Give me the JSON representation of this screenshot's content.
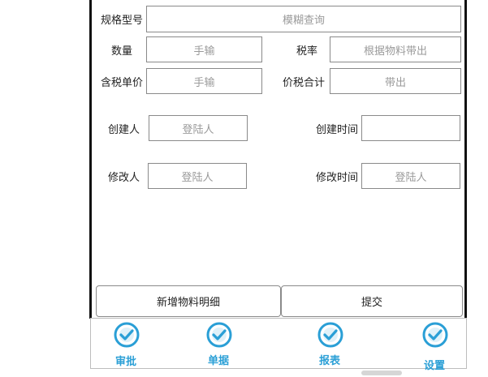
{
  "form": {
    "spec_label": "规格型号",
    "spec_placeholder": "模糊查询",
    "qty_label": "数量",
    "qty_placeholder": "手输",
    "tax_rate_label": "税率",
    "tax_rate_placeholder": "根据物料带出",
    "unit_price_label": "含税单价",
    "unit_price_placeholder": "手输",
    "total_label": "价税合计",
    "total_placeholder": "带出",
    "creator_label": "创建人",
    "creator_placeholder": "登陆人",
    "create_time_label": "创建时间",
    "create_time_value": "",
    "modifier_label": "修改人",
    "modifier_placeholder": "登陆人",
    "modify_time_label": "修改时间",
    "modify_time_placeholder": "登陆人"
  },
  "actions": {
    "add_detail_label": "新增物料明细",
    "submit_label": "提交"
  },
  "tabbar": {
    "items": [
      {
        "label": "审批",
        "icon": "check-circle-icon"
      },
      {
        "label": "单据",
        "icon": "check-circle-icon"
      },
      {
        "label": "报表",
        "icon": "check-circle-icon"
      },
      {
        "label": "设置",
        "icon": "check-circle-icon"
      }
    ],
    "accent": "#2a9fd6"
  }
}
